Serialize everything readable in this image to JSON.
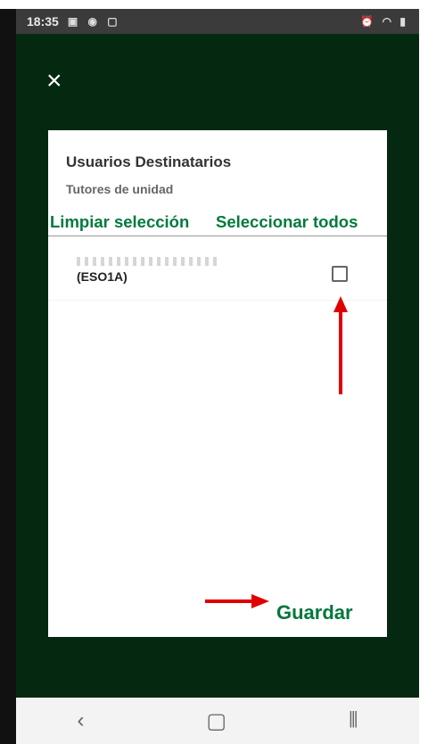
{
  "status_bar": {
    "time": "18:35"
  },
  "dialog": {
    "title": "Usuarios Destinatarios",
    "subtitle": "Tutores de unidad",
    "clear_selection": "Limpiar selección",
    "select_all": "Seleccionar todos",
    "recipient": {
      "group": "(ESO1A)",
      "checked": false
    },
    "save": "Guardar"
  },
  "colors": {
    "background": "#052811",
    "accent": "#00773b",
    "arrow": "#e00000"
  },
  "icons": [
    "close-icon",
    "checkbox",
    "back-icon",
    "home-icon",
    "recents-icon"
  ]
}
